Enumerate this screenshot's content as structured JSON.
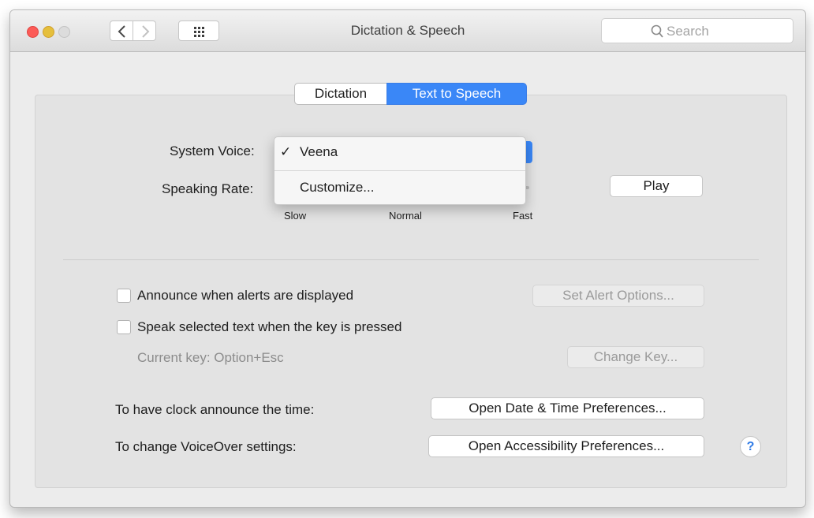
{
  "window": {
    "title": "Dictation & Speech",
    "search_placeholder": "Search"
  },
  "tabs": [
    {
      "label": "Dictation",
      "selected": false
    },
    {
      "label": "Text to Speech",
      "selected": true
    }
  ],
  "voice": {
    "label": "System Voice:",
    "menu": {
      "items": [
        {
          "label": "Veena",
          "checked": true,
          "check_glyph": "✓"
        },
        {
          "label": "Customize...",
          "checked": false
        }
      ]
    }
  },
  "rate": {
    "label": "Speaking Rate:",
    "ticks": [
      "Slow",
      "Normal",
      "Fast"
    ],
    "play_label": "Play"
  },
  "options": {
    "announce_alerts": {
      "label": "Announce when alerts are displayed",
      "checked": false
    },
    "set_alert_options": "Set Alert Options...",
    "speak_selected": {
      "label": "Speak selected text when the key is pressed",
      "checked": false
    },
    "current_key": "Current key: Option+Esc",
    "change_key": "Change Key..."
  },
  "links": {
    "clock_label": "To have clock announce the time:",
    "clock_button": "Open Date & Time Preferences...",
    "voiceover_label": "To change VoiceOver settings:",
    "voiceover_button": "Open Accessibility Preferences..."
  },
  "help": "?",
  "colors": {
    "accent": "#3a87f7",
    "close": "#fc5b57",
    "minimize": "#e5bf3c"
  },
  "icons": [
    "back-icon",
    "forward-icon",
    "grid-icon",
    "search-icon",
    "checkmark-icon",
    "help-icon"
  ]
}
